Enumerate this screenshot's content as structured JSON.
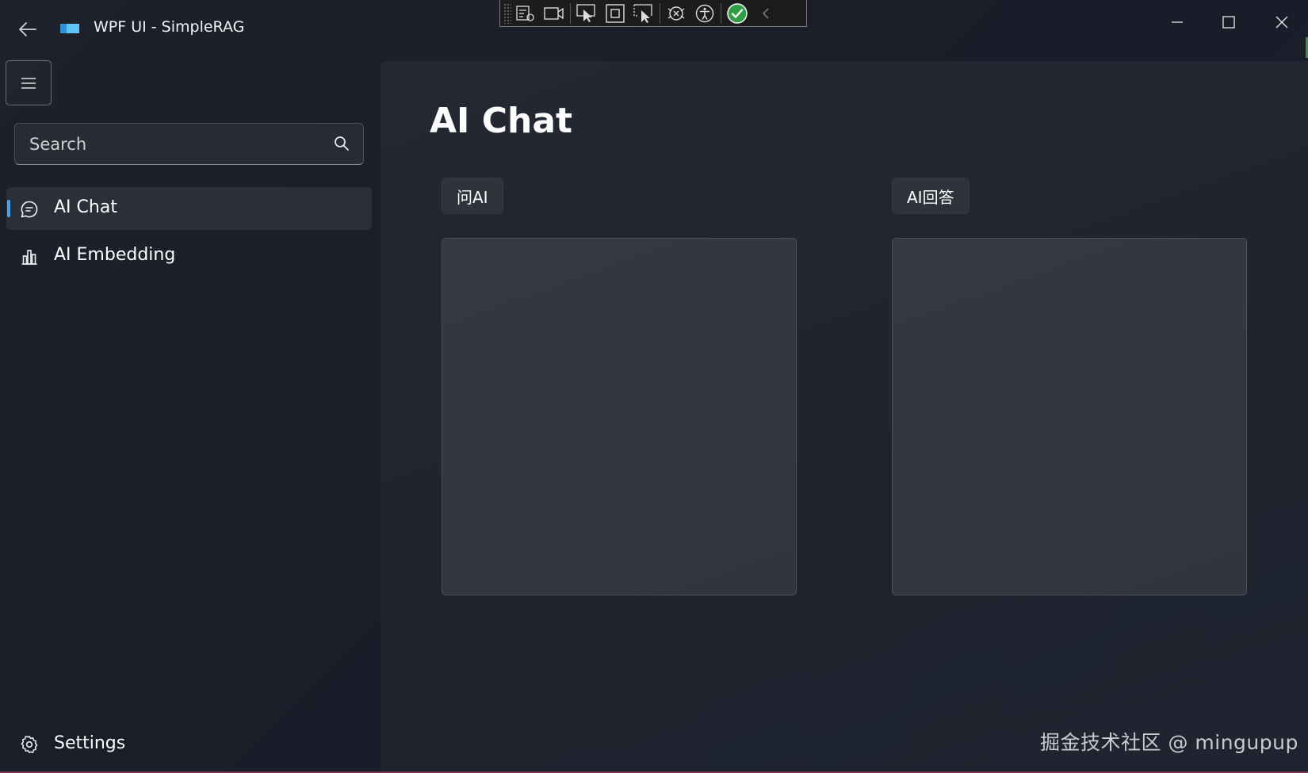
{
  "window": {
    "title": "WPF UI - SimpleRAG"
  },
  "sidebar": {
    "search_placeholder": "Search",
    "items": [
      {
        "label": "AI Chat",
        "icon": "chat-icon",
        "active": true
      },
      {
        "label": "AI Embedding",
        "icon": "bar-chart-icon",
        "active": false
      }
    ],
    "footer": {
      "label": "Settings",
      "icon": "gear-icon"
    }
  },
  "main": {
    "title": "AI Chat",
    "ask_label": "问AI",
    "answer_label": "AI回答",
    "ask_text": "",
    "answer_text": ""
  },
  "watermark": "掘金技术社区 @ mingupup",
  "colors": {
    "accent": "#4aa3f0",
    "background": "#1c202a",
    "panel": "#343840"
  }
}
